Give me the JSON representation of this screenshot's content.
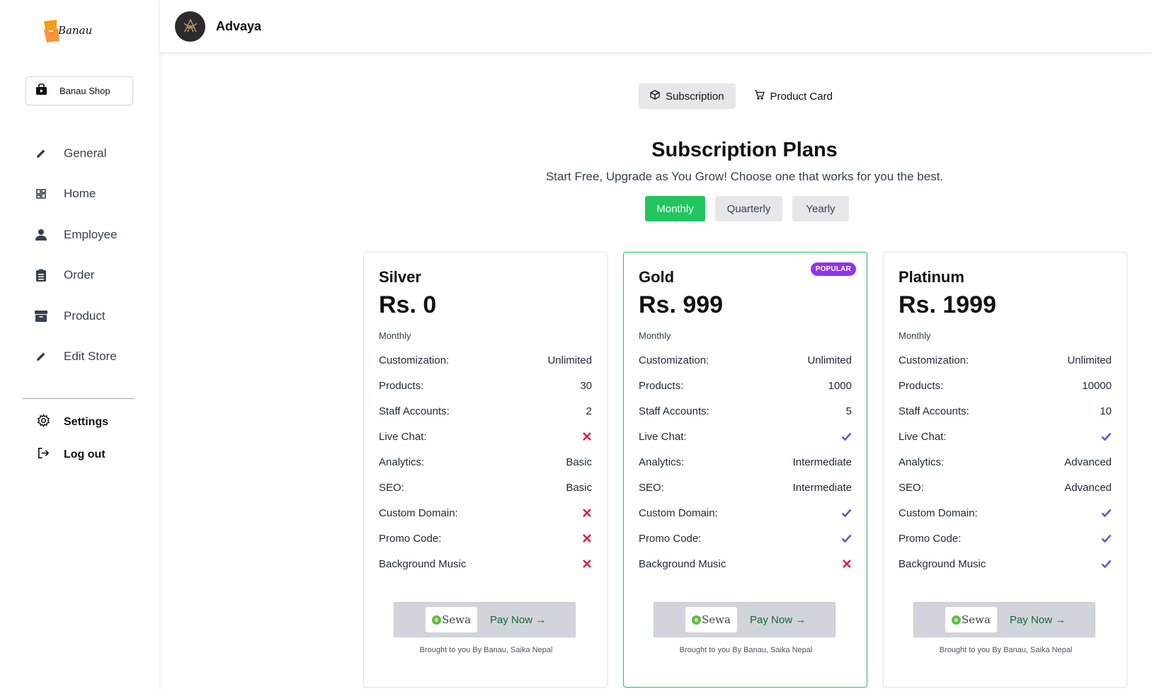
{
  "brand": {
    "name": "Banau"
  },
  "sidebar": {
    "shop_button": "Banau Shop",
    "items": [
      {
        "label": "General",
        "icon": "pencil-icon"
      },
      {
        "label": "Home",
        "icon": "dashboard-icon"
      },
      {
        "label": "Employee",
        "icon": "person-icon"
      },
      {
        "label": "Order",
        "icon": "clipboard-icon"
      },
      {
        "label": "Product",
        "icon": "box-icon"
      },
      {
        "label": "Edit Store",
        "icon": "pencil-icon"
      }
    ],
    "settings": "Settings",
    "logout": "Log out"
  },
  "header": {
    "store_name": "Advaya"
  },
  "tabs": [
    {
      "label": "Subscription",
      "icon": "cube-icon",
      "active": true
    },
    {
      "label": "Product Card",
      "icon": "cart-icon",
      "active": false
    }
  ],
  "page": {
    "title": "Subscription Plans",
    "subtitle": "Start Free, Upgrade as You Grow! Choose one that works for you the best."
  },
  "periods": [
    {
      "label": "Monthly",
      "active": true
    },
    {
      "label": "Quarterly",
      "active": false
    },
    {
      "label": "Yearly",
      "active": false
    }
  ],
  "colors": {
    "accent": "#22c55e",
    "badge": "#9333ea",
    "check": "#6d4fd8",
    "cross": "#e11d48"
  },
  "plans": [
    {
      "name": "Silver",
      "price": "Rs. 0",
      "period": "Monthly",
      "popular": false,
      "features": [
        {
          "label": "Customization:",
          "value": "Unlimited"
        },
        {
          "label": "Products:",
          "value": "30"
        },
        {
          "label": "Staff Accounts:",
          "value": "2"
        },
        {
          "label": "Live Chat:",
          "value": false
        },
        {
          "label": "Analytics:",
          "value": "Basic"
        },
        {
          "label": "SEO:",
          "value": "Basic"
        },
        {
          "label": "Custom Domain:",
          "value": false
        },
        {
          "label": "Promo Code:",
          "value": false
        },
        {
          "label": "Background Music",
          "value": false
        }
      ],
      "pay_logo": "Sewa",
      "pay_label": "Pay Now →",
      "credit": "Brought to you By Banau, Saika Nepal"
    },
    {
      "name": "Gold",
      "price": "Rs. 999",
      "period": "Monthly",
      "popular": true,
      "badge": "POPULAR",
      "features": [
        {
          "label": "Customization:",
          "value": "Unlimited"
        },
        {
          "label": "Products:",
          "value": "1000"
        },
        {
          "label": "Staff Accounts:",
          "value": "5"
        },
        {
          "label": "Live Chat:",
          "value": true
        },
        {
          "label": "Analytics:",
          "value": "Intermediate"
        },
        {
          "label": "SEO:",
          "value": "Intermediate"
        },
        {
          "label": "Custom Domain:",
          "value": true
        },
        {
          "label": "Promo Code:",
          "value": true
        },
        {
          "label": "Background Music",
          "value": false
        }
      ],
      "pay_logo": "Sewa",
      "pay_label": "Pay Now →",
      "credit": "Brought to you By Banau, Saika Nepal"
    },
    {
      "name": "Platinum",
      "price": "Rs. 1999",
      "period": "Monthly",
      "popular": false,
      "features": [
        {
          "label": "Customization:",
          "value": "Unlimited"
        },
        {
          "label": "Products:",
          "value": "10000"
        },
        {
          "label": "Staff Accounts:",
          "value": "10"
        },
        {
          "label": "Live Chat:",
          "value": true
        },
        {
          "label": "Analytics:",
          "value": "Advanced"
        },
        {
          "label": "SEO:",
          "value": "Advanced"
        },
        {
          "label": "Custom Domain:",
          "value": true
        },
        {
          "label": "Promo Code:",
          "value": true
        },
        {
          "label": "Background Music",
          "value": true
        }
      ],
      "pay_logo": "Sewa",
      "pay_label": "Pay Now →",
      "credit": "Brought to you By Banau, Saika Nepal"
    }
  ]
}
